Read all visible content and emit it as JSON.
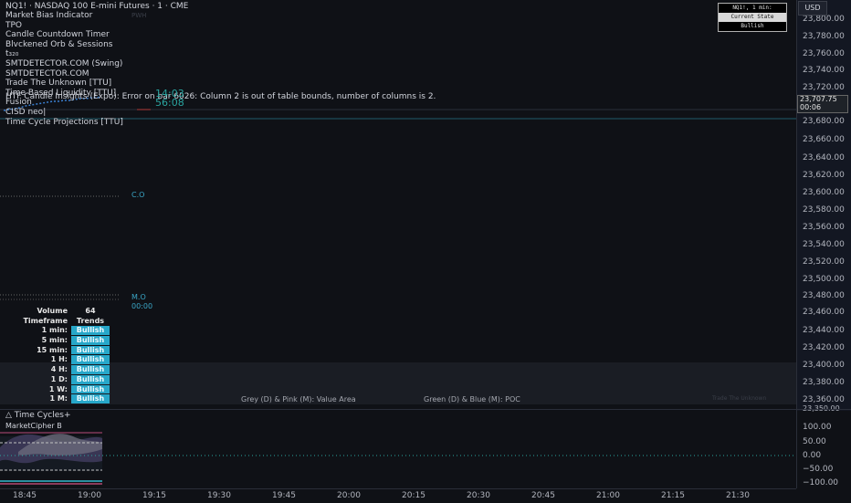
{
  "header": {
    "symbol_title": "NQ1! · NASDAQ 100 E-mini Futures · 1 · CME"
  },
  "indicators": [
    "Market Bias Indicator",
    "TPO",
    "Candle Countdown Timer",
    "Blvckened Orb & Sessions",
    "t₃₂₀",
    "SMTDETECTOR.COM (Swing)",
    "SMTDETECTOR.COM",
    "Trade The Unknown [TTU]",
    "Time Based Liquidity [TTU]",
    "Fusion",
    "CISD neo|",
    "Time Cycle Projections [TTU]"
  ],
  "error_line": "HTF Candle Insights (Expo): Error on bar 6026: Column 2 is out of table bounds, number of columns is 2.",
  "chart_markers": {
    "pwh": "PWH",
    "countdown_top": "14:03",
    "countdown_bottom": "56:08",
    "co": "C.O",
    "mo": "M.O",
    "mo_time": "00:00"
  },
  "state_table": {
    "row1": "NQ1!, 1 min:",
    "row2": "Current State",
    "row3": "Bullish"
  },
  "price_axis": {
    "currency": "USD",
    "labels": [
      "23,800.00",
      "23,780.00",
      "23,760.00",
      "23,740.00",
      "23,720.00",
      "23,700.00",
      "23,680.00",
      "23,660.00",
      "23,640.00",
      "23,620.00",
      "23,600.00",
      "23,580.00",
      "23,560.00",
      "23,540.00",
      "23,520.00",
      "23,500.00",
      "23,480.00",
      "23,460.00",
      "23,440.00",
      "23,420.00",
      "23,400.00",
      "23,380.00",
      "23,360.00",
      "23,350.00"
    ],
    "current_price": "23,707.75",
    "current_countdown": "00:06"
  },
  "trend_table": {
    "header": {
      "c1": "Volume",
      "c2": "64"
    },
    "subheader": {
      "c1": "Timeframe",
      "c2": "Trends"
    },
    "rows": [
      {
        "tf": "1 min:",
        "trend": "Bullish"
      },
      {
        "tf": "5 min:",
        "trend": "Bullish"
      },
      {
        "tf": "15 min:",
        "trend": "Bullish"
      },
      {
        "tf": "1 H:",
        "trend": "Bullish"
      },
      {
        "tf": "4 H:",
        "trend": "Bullish"
      },
      {
        "tf": "1 D:",
        "trend": "Bullish"
      },
      {
        "tf": "1 W:",
        "trend": "Bullish"
      },
      {
        "tf": "1 M:",
        "trend": "Bullish"
      }
    ]
  },
  "legend": {
    "value_area": "Grey (D) & Pink (M): Value Area",
    "poc": "Green (D) & Blue (M): POC",
    "watermark": "Trade The Unknown"
  },
  "lower_pane": {
    "time_cycles": "△ Time Cycles+",
    "market_cipher": "MarketCipher B"
  },
  "osc_axis": [
    "100.00",
    "50.00",
    "0.00",
    "−50.00",
    "−100.00"
  ],
  "time_axis": [
    "18:45",
    "19:00",
    "19:15",
    "19:30",
    "19:45",
    "20:00",
    "20:15",
    "20:30",
    "20:45",
    "21:00",
    "21:15",
    "21:30"
  ],
  "colors": {
    "accent": "#2962ff",
    "bull": "#27a7c9",
    "teal": "#2aa5a0"
  }
}
